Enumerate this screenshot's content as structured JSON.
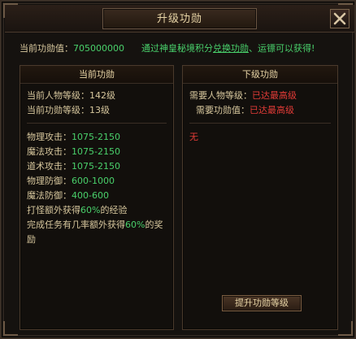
{
  "window": {
    "title": "升级功勋",
    "close_icon": "close-icon"
  },
  "summary": {
    "label": "当前功勋值：",
    "value": "705000000",
    "tip_prefix": "通过神皇秘境积分",
    "tip_link": "兑换功勋",
    "tip_suffix": "、运镖可以获得!"
  },
  "current": {
    "title": "当前功勋",
    "char_level_label": "当前人物等级：",
    "char_level_value": "142级",
    "merit_level_label": "当前功勋等级：",
    "merit_level_value": "13级",
    "stats": [
      {
        "label": "物理攻击：",
        "value": "1075-2150"
      },
      {
        "label": "魔法攻击：",
        "value": "1075-2150"
      },
      {
        "label": "道术攻击：",
        "value": "1075-2150"
      },
      {
        "label": "物理防御：",
        "value": "600-1000"
      },
      {
        "label": "魔法防御：",
        "value": "400-600"
      }
    ],
    "exp_bonus_prefix": "打怪额外获得",
    "exp_bonus_value": "60%",
    "exp_bonus_suffix": "的经验",
    "task_bonus_prefix": "完成任务有几率额外获得",
    "task_bonus_value": "60%",
    "task_bonus_suffix": "的奖励"
  },
  "next": {
    "title": "下级功勋",
    "req_char_label": "需要人物等级：",
    "req_char_value": "已达最高级",
    "req_merit_label": "需要功勋值：",
    "req_merit_value": "已达最高级",
    "none_text": "无",
    "upgrade_button": "提升功勋等级"
  },
  "colors": {
    "green": "#49d06b",
    "red": "#e23b37",
    "gold": "#e8d5a6"
  }
}
